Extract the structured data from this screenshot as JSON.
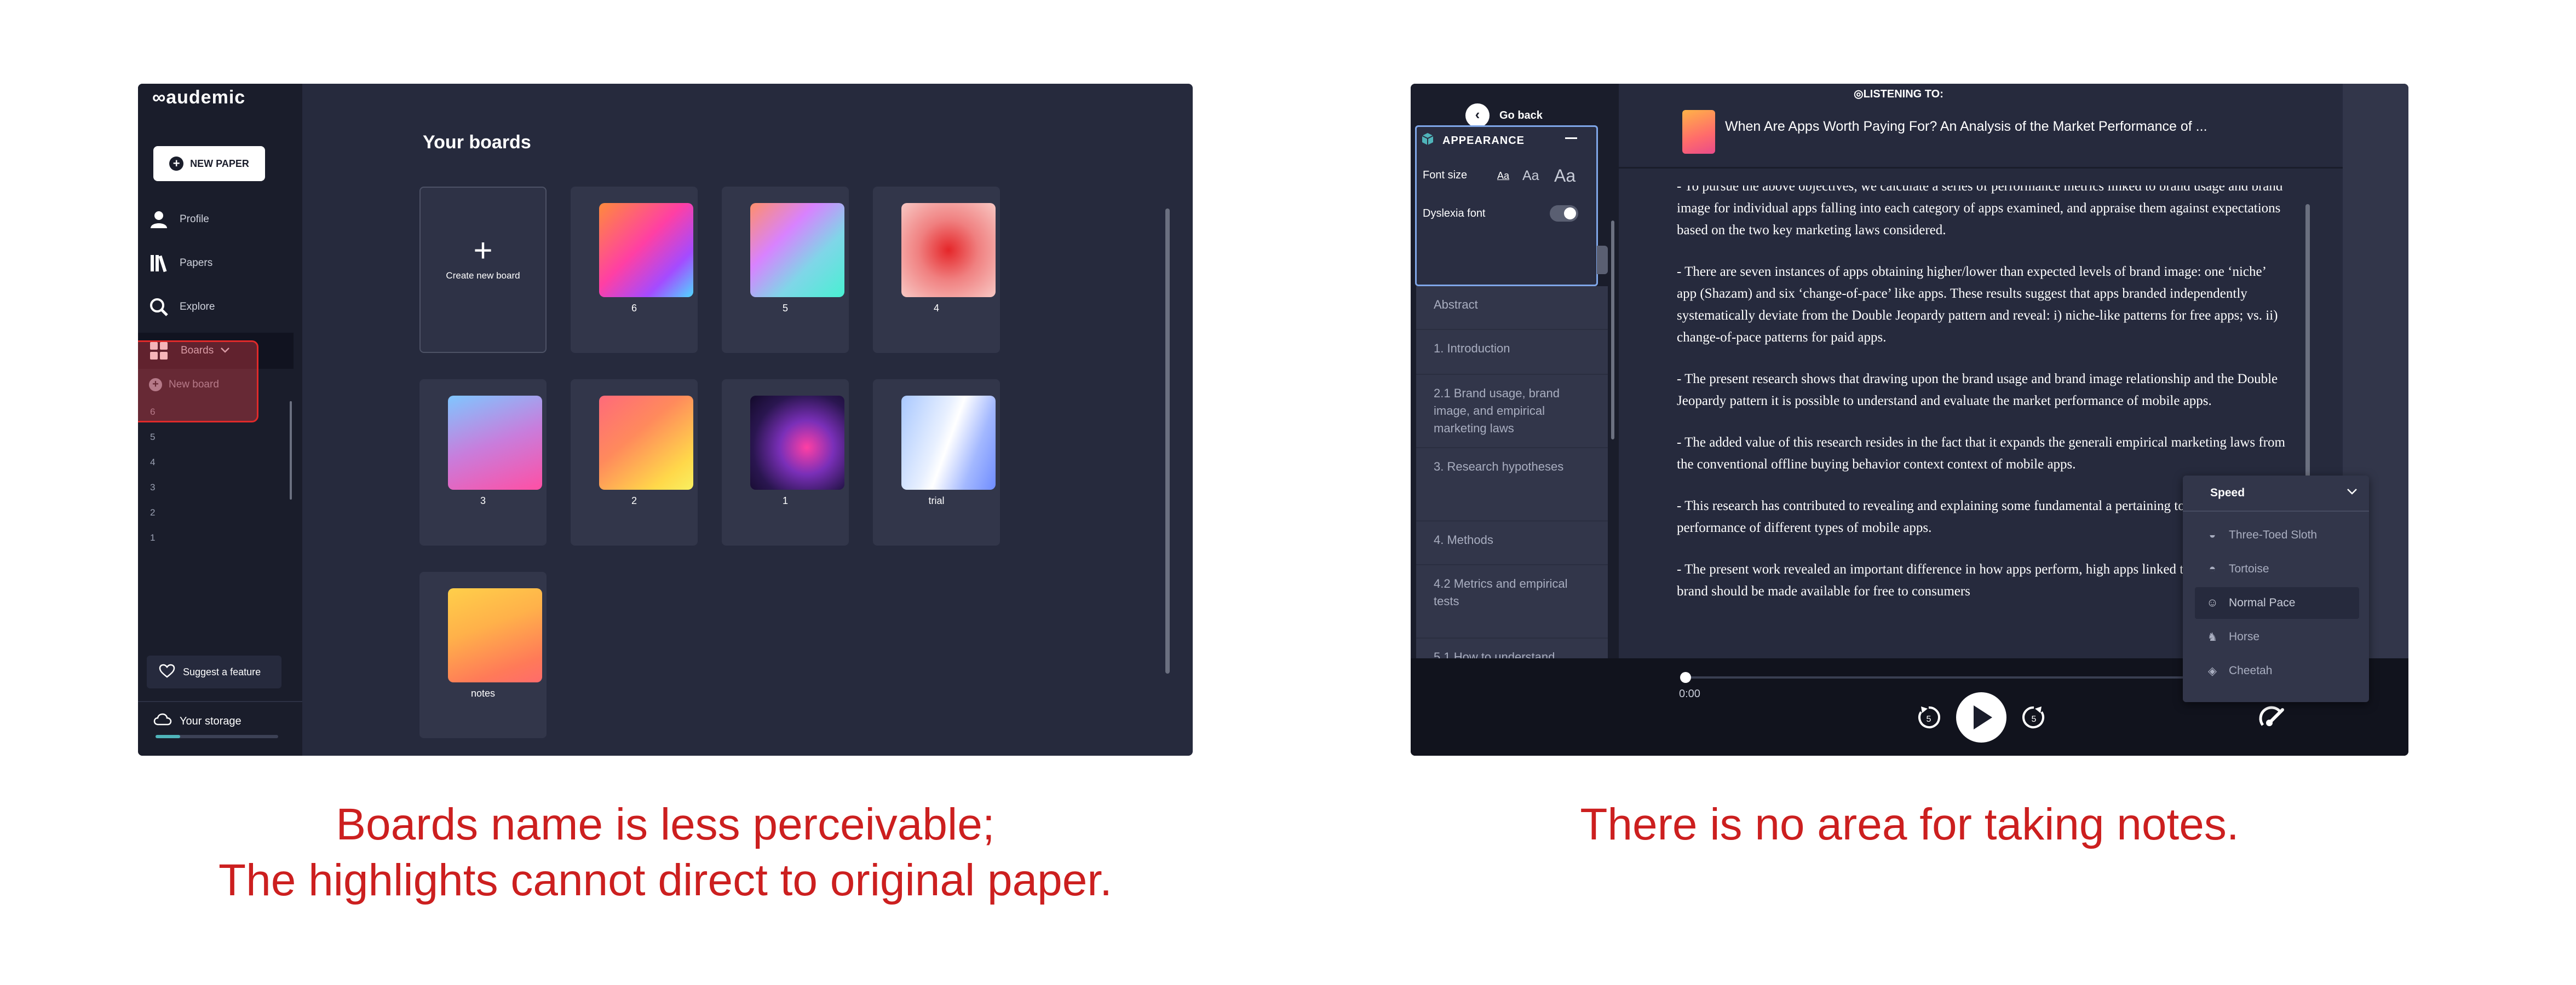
{
  "left": {
    "logo": "∞audemic",
    "new_paper": "NEW PAPER",
    "nav": {
      "profile": "Profile",
      "papers": "Papers",
      "explore": "Explore",
      "boards": "Boards",
      "new_board": "New board"
    },
    "board_numbers": [
      "6",
      "5",
      "4",
      "3",
      "2",
      "1"
    ],
    "suggest_feature": "Suggest a feature",
    "your_storage": "Your storage",
    "storage_used_fraction": 0.2,
    "main_title": "Your boards",
    "create_new_board": "Create new board",
    "boards": [
      {
        "label": "6",
        "gradient": "linear-gradient(135deg,#ff8a3c 0%,#ff3fa4 45%,#a44bff 75%,#4fd7ff 100%)"
      },
      {
        "label": "5",
        "gradient": "linear-gradient(135deg,#ff8f6b 0%,#d882ff 35%,#7fd6e8 65%,#48f0d2 100%)"
      },
      {
        "label": "4",
        "gradient": "radial-gradient(circle at 50% 50%,#e52629 0%,#f08080 45%,#f8c8c4 100%)"
      },
      {
        "label": "3",
        "gradient": "linear-gradient(160deg,#7fc6ff 0%,#c87ddc 50%,#ff4fa4 100%)"
      },
      {
        "label": "2",
        "gradient": "linear-gradient(140deg,#ff6a7a 0%,#ff8a5c 40%,#ffd84a 80%,#f8f060 100%)"
      },
      {
        "label": "1",
        "gradient": "radial-gradient(circle at 60% 55%,#ff3fa4 0%,#7a2fb8 35%,#2a1650 70%,#130a2a 100%)"
      },
      {
        "label": "trial",
        "gradient": "linear-gradient(110deg,#a9c8ff 0%,#e8f0ff 40%,#ffffff 50%,#a3b8ff 75%,#6f8cff 100%)"
      },
      {
        "label": "notes",
        "gradient": "linear-gradient(160deg,#ffcf4a 0%,#ffb14a 40%,#ff7a58 80%,#ff6b6b 100%)"
      }
    ]
  },
  "right": {
    "go_back": "Go back",
    "appearance": "APPEARANCE",
    "font_size": "Font size",
    "font_options": [
      "Aa",
      "Aa",
      "Aa"
    ],
    "dyslexia_font": "Dyslexia font",
    "dyslexia_enabled": false,
    "toc": [
      "Abstract",
      "1. Introduction",
      "2.1 Brand usage, brand image, and empirical marketing laws",
      "3. Research hypotheses",
      "4. Methods",
      "4.2 Metrics and empirical tests",
      "5.1 How to understand"
    ],
    "listening_to": "LISTENING TO:",
    "paper_title": "When Are Apps Worth Paying For? An Analysis of the Market Performance of ...",
    "paragraphs": [
      "- To pursue the above objectives, we calculate a series of performance metrics linked to brand usage and brand image for individual apps falling into each category of apps examined, and appraise them against expectations based on the two key marketing laws considered.",
      "- There are seven instances of apps obtaining higher/lower than expected levels of brand image: one ‘niche’ app (Shazam) and six ‘change-of-pace’ like apps. These results suggest that apps branded independently systematically deviate from the Double Jeopardy pattern and reveal: i) niche-like patterns for free apps; vs. ii) change-of-pace patterns for paid apps.",
      "- The present research shows that drawing upon the brand usage and brand image relationship and the Double Jeopardy pattern it is possible to understand and evaluate the market performance of mobile apps.",
      "- The added value of this research resides in the fact that it expands the generali empirical marketing laws from the conventional offline buying behavior context context of mobile apps.",
      "- This research has contributed to revealing and explaining some fundamental a pertaining to the market performance of different types of mobile apps.",
      "- The present work revealed an important difference in how apps perform, high apps linked to an existing brand should be made available for free to consumers"
    ],
    "speed": {
      "title": "Speed",
      "options": [
        "Three-Toed Sloth",
        "Tortoise",
        "Normal Pace",
        "Horse",
        "Cheetah"
      ],
      "selected": "Normal Pace"
    },
    "time_current": "0:00",
    "progress_fraction": 0.0
  },
  "captions": {
    "left_line1": "Boards name is less perceivable;",
    "left_line2": "The highlights cannot direct to original paper.",
    "right": "There is no area for taking notes."
  },
  "colors": {
    "app_bg": "#262a3d",
    "sidebar_bg": "#1a1d2b",
    "card_bg": "#32364a",
    "caption_red": "#cc1f1f",
    "highlight_red": "#e02a2a",
    "appearance_border": "#7fa6e8"
  }
}
